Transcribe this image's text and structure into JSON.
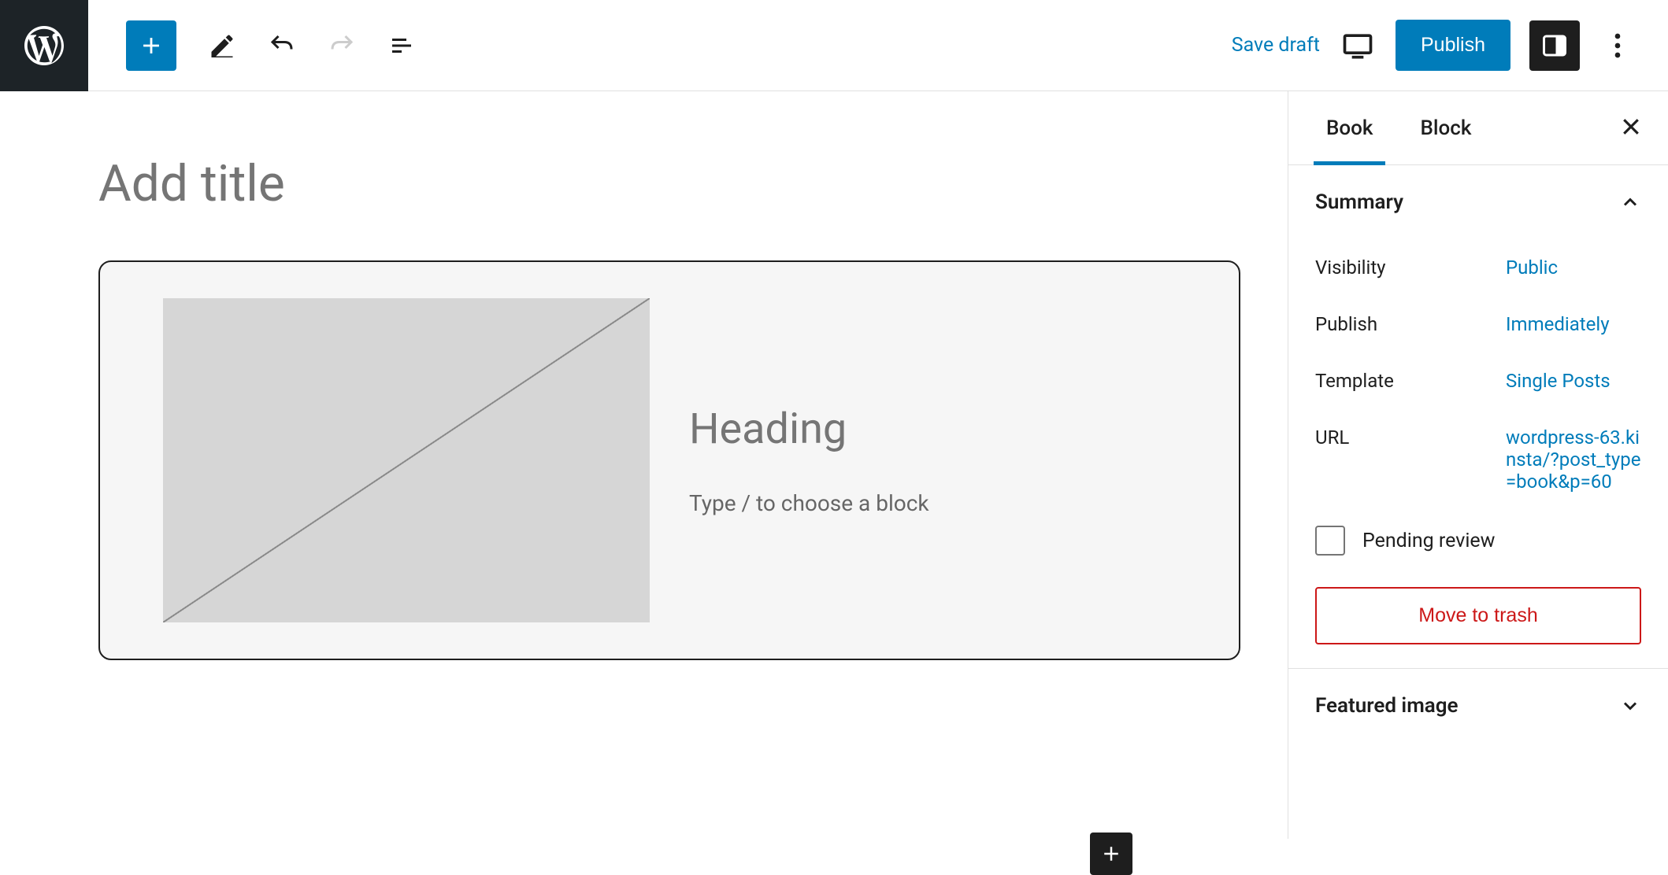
{
  "toolbar": {
    "save_draft": "Save draft",
    "publish": "Publish"
  },
  "editor": {
    "title_placeholder": "Add title",
    "heading_placeholder": "Heading",
    "block_hint": "Type / to choose a block"
  },
  "sidebar": {
    "tabs": [
      "Book",
      "Block"
    ],
    "panels": {
      "summary": {
        "title": "Summary",
        "rows": {
          "visibility": {
            "label": "Visibility",
            "value": "Public"
          },
          "publish": {
            "label": "Publish",
            "value": "Immediately"
          },
          "template": {
            "label": "Template",
            "value": "Single Posts"
          },
          "url": {
            "label": "URL",
            "value": "wordpress-63.kinsta/?post_type=book&p=60"
          }
        },
        "pending_review": "Pending review",
        "trash": "Move to trash"
      },
      "featured_image": {
        "title": "Featured image"
      }
    }
  }
}
